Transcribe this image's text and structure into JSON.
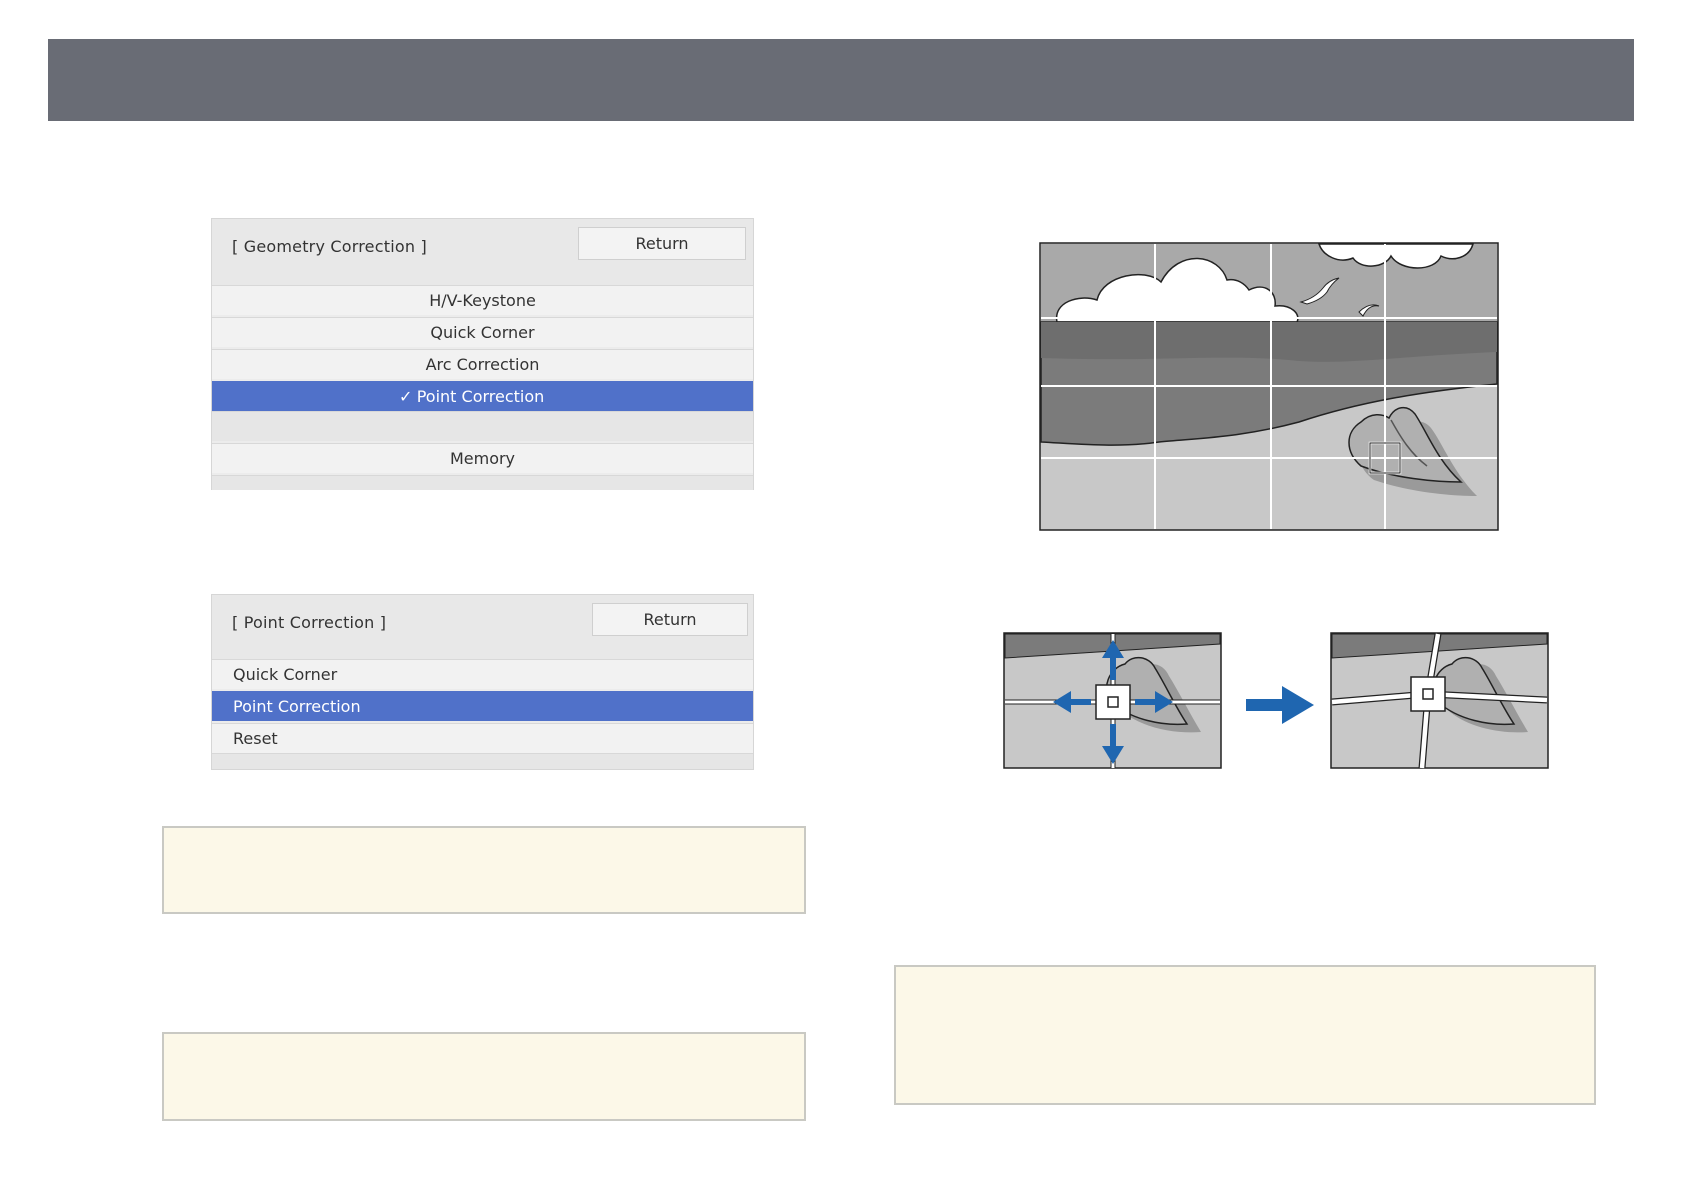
{
  "geometry_menu": {
    "title": "[ Geometry Correction ]",
    "return_label": "Return",
    "items": [
      {
        "label": "H/V-Keystone"
      },
      {
        "label": "Quick Corner"
      },
      {
        "label": "Arc Correction"
      },
      {
        "label": "Point Correction",
        "selected": true
      },
      {
        "label": ""
      },
      {
        "label": "Memory"
      }
    ],
    "check_glyph": "✓"
  },
  "point_menu": {
    "title": "[ Point Correction ]",
    "return_label": "Return",
    "items": [
      {
        "label": "Quick Corner"
      },
      {
        "label": "Point Correction",
        "selected": true
      },
      {
        "label": "Reset"
      }
    ]
  },
  "colors": {
    "header": "#696c75",
    "selection": "#5071c9",
    "note_bg": "#fcf8e8",
    "arrow_blue": "#1f66b0"
  },
  "icons": [
    "check-icon",
    "arrow-up-icon",
    "arrow-down-icon",
    "arrow-left-icon",
    "arrow-right-icon",
    "arrow-next-icon"
  ]
}
